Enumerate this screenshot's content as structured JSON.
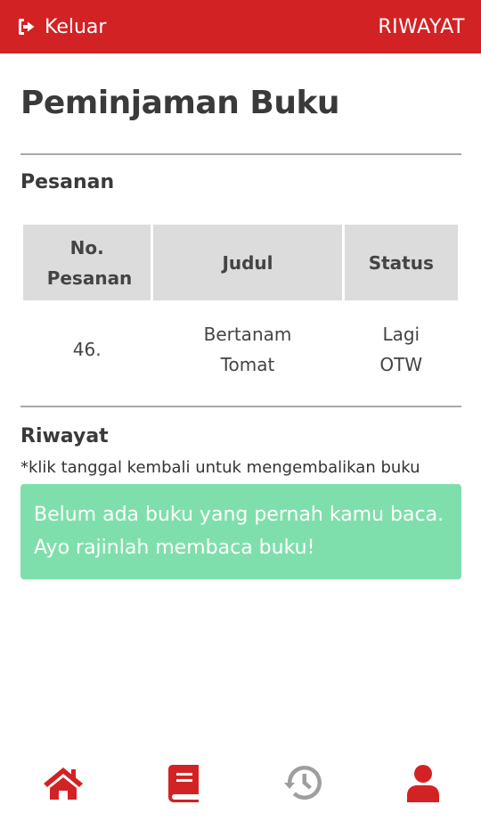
{
  "header": {
    "logout_label": "Keluar",
    "logout_icon": "sign-out-icon",
    "history_link": "RIWAYAT",
    "bg_color": "#d32224"
  },
  "page": {
    "title": "Peminjaman Buku"
  },
  "pesanan": {
    "title": "Pesanan",
    "columns": [
      "No. Pesanan",
      "Judul",
      "Status"
    ],
    "rows": [
      {
        "no": "46.",
        "judul": "Bertanam Tomat",
        "status": "Lagi OTW"
      }
    ]
  },
  "riwayat": {
    "title": "Riwayat",
    "note": "*klik tanggal kembali untuk mengembalikan buku",
    "empty_message": "Belum ada buku yang pernah kamu baca. Ayo rajinlah membaca buku!",
    "alert_color": "#7fdfac"
  },
  "bottom_nav": {
    "items": [
      {
        "icon": "home-icon",
        "active": true
      },
      {
        "icon": "book-icon",
        "active": true
      },
      {
        "icon": "history-icon",
        "active": false
      },
      {
        "icon": "user-icon",
        "active": true
      }
    ],
    "active_color": "#d32224",
    "inactive_color": "#9e9e9e"
  }
}
